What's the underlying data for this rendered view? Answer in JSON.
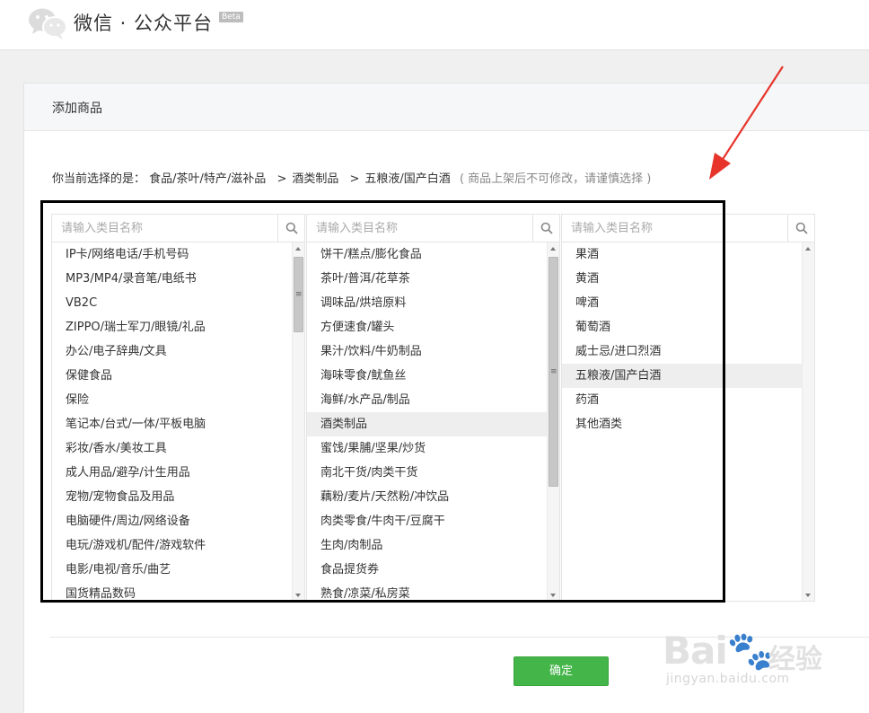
{
  "header": {
    "title": "微信 · 公众平台",
    "badge": "Beta"
  },
  "panel": {
    "title": "添加商品",
    "current_label": "你当前选择的是：",
    "path": [
      "食品/茶叶/特产/滋补品",
      "酒类制品",
      "五粮液/国产白酒"
    ],
    "path_separator": ">",
    "note": "( 商品上架后不可修改，请谨慎选择 )"
  },
  "columns": [
    {
      "placeholder": "请输入类目名称",
      "items": [
        "IP卡/网络电话/手机号码",
        "MP3/MP4/录音笔/电纸书",
        "VB2C",
        "ZIPPO/瑞士军刀/眼镜/礼品",
        "办公/电子辞典/文具",
        "保健食品",
        "保险",
        "笔记本/台式/一体/平板电脑",
        "彩妆/香水/美妆工具",
        "成人用品/避孕/计生用品",
        "宠物/宠物食品及用品",
        "电脑硬件/周边/网络设备",
        "电玩/游戏机/配件/游戏软件",
        "电影/电视/音乐/曲艺",
        "国货精品数码"
      ],
      "selected": null
    },
    {
      "placeholder": "请输入类目名称",
      "items": [
        "饼干/糕点/膨化食品",
        "茶叶/普洱/花草茶",
        "调味品/烘培原料",
        "方便速食/罐头",
        "果汁/饮料/牛奶制品",
        "海味零食/鱿鱼丝",
        "海鲜/水产品/制品",
        "酒类制品",
        "蜜饯/果脯/坚果/炒货",
        "南北干货/肉类干货",
        "藕粉/麦片/天然粉/冲饮品",
        "肉类零食/牛肉干/豆腐干",
        "生肉/肉制品",
        "食品提货券",
        "熟食/凉菜/私房菜"
      ],
      "selected": 7
    },
    {
      "placeholder": "请输入类目名称",
      "items": [
        "果酒",
        "黄酒",
        "啤酒",
        "葡萄酒",
        "威士忌/进口烈酒",
        "五粮液/国产白酒",
        "药酒",
        "其他酒类"
      ],
      "selected": 5
    }
  ],
  "actions": {
    "confirm_label": "确定"
  },
  "watermark": {
    "brand": "Bai",
    "brand_suffix": "经验",
    "url": "jingyan.baidu.com"
  },
  "colors": {
    "primary_green": "#44b549",
    "annotation_red": "#e8352c",
    "selected_row": "#eeeeee"
  }
}
